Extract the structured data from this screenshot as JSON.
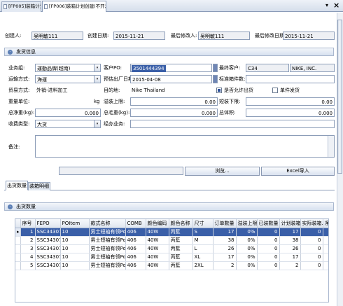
{
  "tabs": [
    {
      "label": "[FP005]装箱计划",
      "active": false
    },
    {
      "label": "[FP006]装箱计划创建(不开发用户",
      "active": true
    }
  ],
  "window": {
    "close_glyph": "×",
    "dropdown_glyph": "▾"
  },
  "header_info": {
    "creator_label": "创建人:",
    "creator": "吴明敏111",
    "create_date_label": "创建日期:",
    "create_date": "2015-11-21",
    "modifier_label": "最后修改人:",
    "modifier": "吴明敏111",
    "modify_date_label": "最后修改日期:",
    "modify_date": "2015-11-21"
  },
  "shipping": {
    "section_title": "发货信息",
    "business_group_label": "业务组:",
    "business_group": "運動品牌(越南)",
    "customer_po_label": "客户PO:",
    "customer_po": "3501444394",
    "final_customer_label": "最终客户:",
    "final_customer_code": "C34",
    "final_customer_name": "NIKE, INC.",
    "transport_label": "运输方式:",
    "transport": "海運",
    "est_ship_date_label": "预估出厂日期:",
    "est_ship_date": "2015-04-08",
    "label_count_label": "标准箱件数:",
    "label_count": "",
    "trade_mode_label": "贸易方式:",
    "trade_mode": "外销-进料加工",
    "destination_label": "目的地:",
    "destination": "Nike Thailand",
    "allow_split_label": "是否允许出货",
    "allow_split": true,
    "single_ship_label": "单件发货",
    "single_ship": false,
    "weight_unit_label": "重量单位:",
    "weight_unit": "kg",
    "overflow_upper_label": "溢装上限:",
    "overflow_upper": "0.00",
    "short_lower_label": "短装下限:",
    "short_lower": "0.00",
    "net_weight_label": "总净重(kg):",
    "net_weight": "0.000",
    "gross_weight_label": "总毛重(kg):",
    "gross_weight": "0.000",
    "total_volume_label": "总体积:",
    "total_volume": "0.000",
    "receipt_type_label": "收费类型:",
    "receipt_type": "大货",
    "via_label": "经办业务:",
    "via": "",
    "remark_label": "备注:",
    "remark": ""
  },
  "buttons": {
    "browse": "浏览...",
    "excel_import": "Excel导入"
  },
  "detail_tabs": [
    {
      "label": "出货数量",
      "active": true
    },
    {
      "label": "装箱明细",
      "active": false
    }
  ],
  "qty_section_title": "出货数量",
  "table": {
    "columns": [
      "序号",
      "FEPO",
      "POItem",
      "款式名称",
      "COMB",
      "颜色编码",
      "颜色名称",
      "尺寸",
      "订单数量",
      "溢装上限",
      "已装数量",
      "计划装箱...",
      "实际装箱...",
      "净"
    ],
    "rows": [
      [
        "1",
        "SSC34307...",
        "10",
        "男士短袖有领Po...",
        "406",
        "40W",
        "丙藍",
        "S",
        "17",
        "0%",
        "0",
        "17",
        "0",
        ""
      ],
      [
        "2",
        "SSC34307...",
        "10",
        "男士短袖有领Po...",
        "406",
        "40W",
        "丙藍",
        "M",
        "38",
        "0%",
        "0",
        "38",
        "0",
        ""
      ],
      [
        "3",
        "SSC34307...",
        "10",
        "男士短袖有领Po...",
        "406",
        "40W",
        "丙藍",
        "L",
        "26",
        "0%",
        "0",
        "26",
        "0",
        ""
      ],
      [
        "4",
        "SSC34307...",
        "10",
        "男士短袖有领Po...",
        "406",
        "40W",
        "丙藍",
        "XL",
        "17",
        "0%",
        "0",
        "17",
        "0",
        ""
      ],
      [
        "5",
        "SSC34307...",
        "10",
        "男士短袖有领Po...",
        "406",
        "40W",
        "丙藍",
        "2XL",
        "2",
        "0%",
        "0",
        "2",
        "0",
        ""
      ]
    ]
  }
}
